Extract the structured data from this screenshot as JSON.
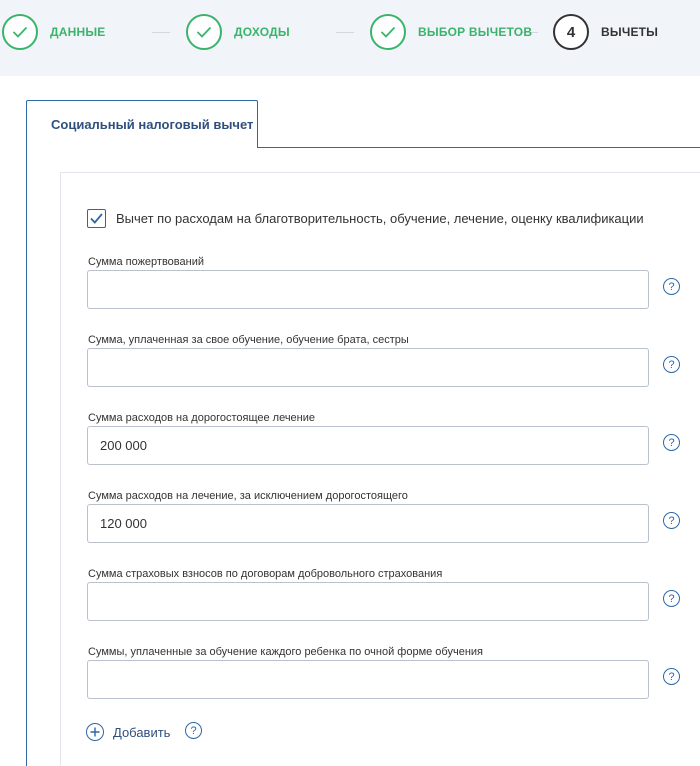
{
  "stepper": {
    "steps": [
      {
        "label": "ДАННЫЕ",
        "state": "done",
        "icon": "check-icon"
      },
      {
        "label": "ДОХОДЫ",
        "state": "done",
        "icon": "check-icon"
      },
      {
        "label": "ВЫБОР ВЫЧЕТОВ",
        "state": "done",
        "icon": "check-icon"
      },
      {
        "label": "ВЫЧЕТЫ",
        "state": "current",
        "number": "4"
      }
    ],
    "done_color": "#3ab36b",
    "current_color": "#333333"
  },
  "tab": {
    "label": "Социальный налоговый вычет"
  },
  "form": {
    "checkbox_label": "Вычет по расходам на благотворительность, обучение, лечение, оценку квалификации",
    "checkbox_checked": true,
    "fields": [
      {
        "label": "Сумма пожертвований",
        "value": ""
      },
      {
        "label": "Сумма, уплаченная за свое обучение, обучение брата, сестры",
        "value": ""
      },
      {
        "label": "Сумма расходов на дорогостоящее лечение",
        "value": "200 000"
      },
      {
        "label": "Сумма расходов на лечение, за исключением дорогостоящего",
        "value": "120 000"
      },
      {
        "label": "Сумма страховых взносов по договорам добровольного страхования",
        "value": ""
      },
      {
        "label": "Суммы, уплаченные за обучение каждого ребенка по очной форме обучения",
        "value": ""
      }
    ],
    "help_glyph": "?",
    "add_label": "Добавить"
  },
  "colors": {
    "accent": "#2f67a6",
    "success": "#3ab36b"
  }
}
